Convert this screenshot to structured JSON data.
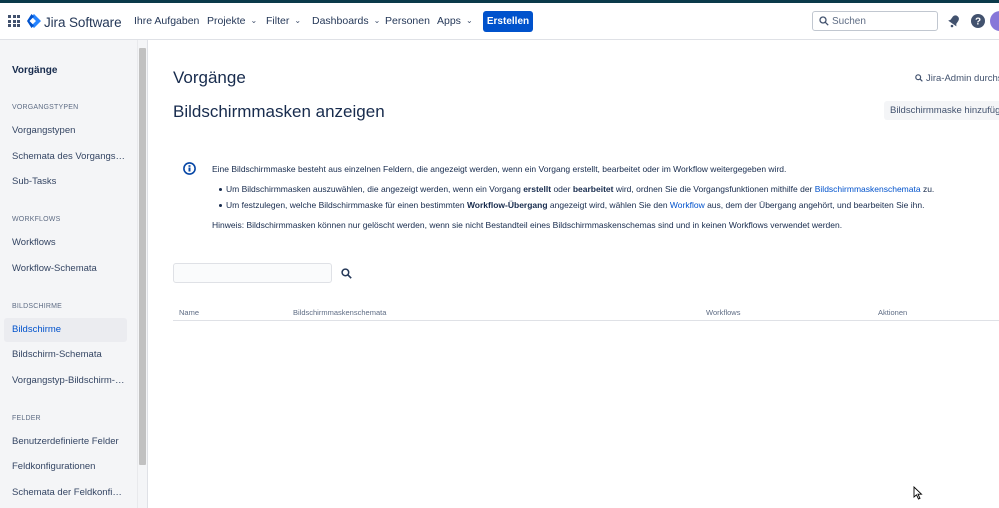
{
  "header": {
    "logo_text": "Jira Software",
    "nav": [
      {
        "label": "Ihre Aufgaben",
        "chevron": false
      },
      {
        "label": "Projekte",
        "chevron": true
      },
      {
        "label": "Filter",
        "chevron": true
      },
      {
        "label": "Dashboards",
        "chevron": true
      },
      {
        "label": "Personen",
        "chevron": false
      },
      {
        "label": "Apps",
        "chevron": true
      }
    ],
    "create_label": "Erstellen",
    "search_placeholder": "Suchen",
    "accent": "#0052cc"
  },
  "sidebar": {
    "title": "Vorgänge",
    "sections": [
      {
        "heading": "VORGANGSTYPEN",
        "items": [
          "Vorgangstypen",
          "Schemata des Vorgangstyps",
          "Sub-Tasks"
        ]
      },
      {
        "heading": "WORKFLOWS",
        "items": [
          "Workflows",
          "Workflow-Schemata"
        ]
      },
      {
        "heading": "BILDSCHIRME",
        "items": [
          "Bildschirme",
          "Bildschirm-Schemata",
          "Vorgangstyp-Bildschirm-Schemata"
        ]
      },
      {
        "heading": "FELDER",
        "items": [
          "Benutzerdefinierte Felder",
          "Feldkonfigurationen",
          "Schemata der Feldkonfigurationen"
        ]
      }
    ],
    "active_item": "Bildschirme"
  },
  "main": {
    "title": "Vorgänge",
    "subtitle": "Bildschirmmasken anzeigen",
    "admin_link": "Jira-Admin durchsuchen",
    "add_button": "Bildschirmmaske hinzufügen",
    "info": {
      "intro": "Eine Bildschirmmaske besteht aus einzelnen Feldern, die angezeigt werden, wenn ein Vorgang erstellt, bearbeitet oder im Workflow weitergegeben wird.",
      "b1_pre": "Um Bildschirmmasken auszuwählen, die angezeigt werden, wenn ein Vorgang ",
      "b1_bold1": "erstellt",
      "b1_mid": " oder ",
      "b1_bold2": "bearbeitet",
      "b1_post": " wird, ordnen Sie die Vorgangsfunktionen mithilfe der ",
      "b1_link": "Bildschirmmaskenschemata",
      "b1_end": " zu.",
      "b2_pre": "Um festzulegen, welche Bildschirmmaske für einen bestimmten ",
      "b2_bold": "Workflow-Übergang",
      "b2_mid": " angezeigt wird, wählen Sie den ",
      "b2_link": "Workflow",
      "b2_post": " aus, dem der Übergang angehört, und bearbeiten Sie ihn.",
      "hint": "Hinweis: Bildschirmmasken können nur gelöscht werden, wenn sie nicht Bestandteil eines Bildschirmmaskenschemas sind und in keinen Workflows verwendet werden."
    },
    "filter_value": "",
    "columns": [
      "Name",
      "Bildschirmmaskenschemata",
      "Workflows",
      "Aktionen"
    ]
  }
}
